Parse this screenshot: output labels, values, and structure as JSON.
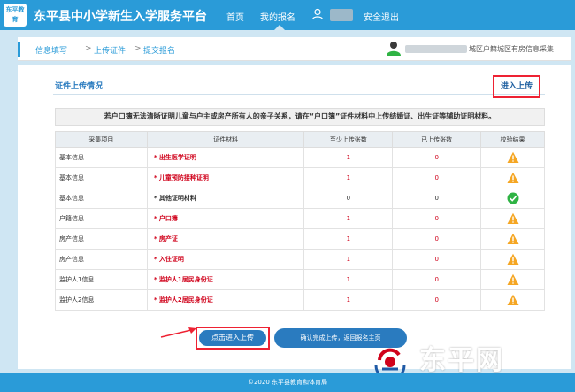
{
  "header": {
    "logo_text": "东平教育",
    "site_title": "东平县中小学新生入学服务平台",
    "nav_home": "首页",
    "nav_mine": "我的报名",
    "logout": "安全退出"
  },
  "breadcrumb": {
    "step1": "信息填写",
    "sep": ">",
    "step2": "上传证件",
    "step3": "提交报名",
    "user_info": "城区户籍城区有房信息采集"
  },
  "section": {
    "title": "证件上传情况",
    "upload_link": "进入上传"
  },
  "notice": "若户口簿无法清晰证明儿童与户主或房产所有人的亲子关系，请在“户口簿”证件材料中上传结婚证、出生证等辅助证明材料。",
  "table": {
    "headers": [
      "采集项目",
      "证件材料",
      "至少上传张数",
      "已上传张数",
      "校验结果"
    ],
    "rows": [
      {
        "category": "基本信息",
        "material": "* 出生医学证明",
        "required": true,
        "min": "1",
        "uploaded": "0",
        "status": "warning"
      },
      {
        "category": "基本信息",
        "material": "* 儿童预防接种证明",
        "required": true,
        "min": "1",
        "uploaded": "0",
        "status": "warning"
      },
      {
        "category": "基本信息",
        "material": "* 其他证明材料",
        "required": false,
        "min": "0",
        "uploaded": "0",
        "status": "ok"
      },
      {
        "category": "户籍信息",
        "material": "* 户口簿",
        "required": true,
        "min": "1",
        "uploaded": "0",
        "status": "warning"
      },
      {
        "category": "房产信息",
        "material": "* 房产证",
        "required": true,
        "min": "1",
        "uploaded": "0",
        "status": "warning"
      },
      {
        "category": "房产信息",
        "material": "* 入住证明",
        "required": true,
        "min": "1",
        "uploaded": "0",
        "status": "warning"
      },
      {
        "category": "监护人1信息",
        "material": "* 监护人1居民身份证",
        "required": true,
        "min": "1",
        "uploaded": "0",
        "status": "warning"
      },
      {
        "category": "监护人2信息",
        "material": "* 监护人2居民身份证",
        "required": true,
        "min": "1",
        "uploaded": "0",
        "status": "warning"
      }
    ]
  },
  "buttons": {
    "upload": "点击进入上传",
    "confirm": "确认完成上传，返回报名主页"
  },
  "watermark": "东平网",
  "footer": "©2020  东平县教育和体育局",
  "colors": {
    "primary": "#2a9bd8",
    "button": "#2a7bbf",
    "required_red": "#d0021b",
    "highlight_border": "#ee2233",
    "warning": "#f5a623",
    "ok": "#2fb344"
  }
}
